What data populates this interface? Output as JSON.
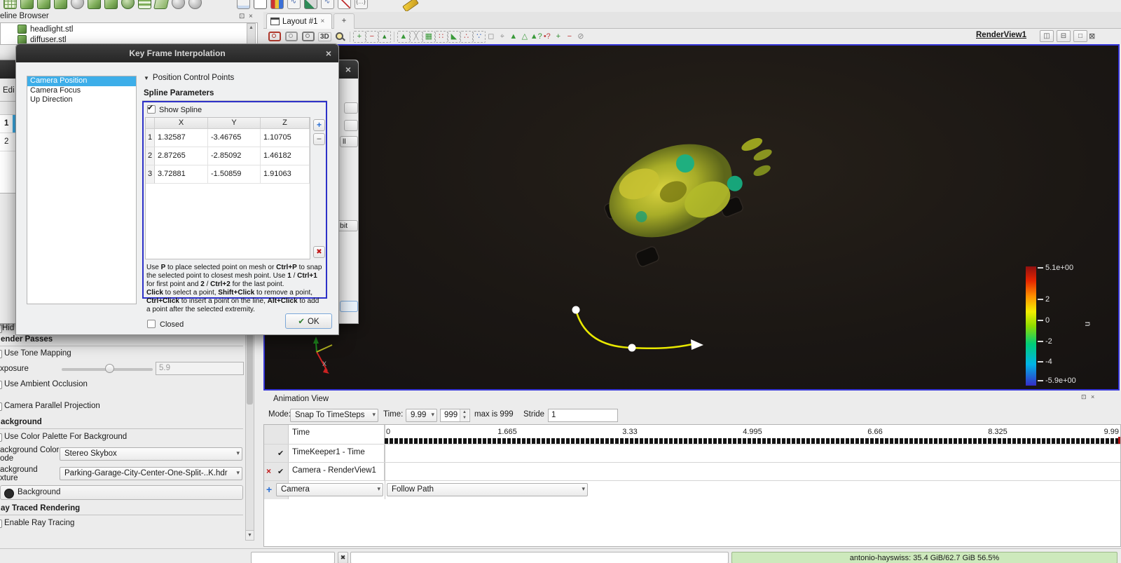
{
  "toolbar_top": {
    "icons": [
      "grid",
      "shape",
      "shape",
      "shape",
      "sphere",
      "shape",
      "shape",
      "globe",
      "layers",
      "plane",
      "sphere",
      "sphere",
      "gap",
      "flag",
      "window",
      "chart",
      "wave",
      "brush",
      "wave",
      "axes",
      "braces",
      "gap",
      "pencil"
    ]
  },
  "pipeline_browser": {
    "title": "eline Browser",
    "float_icon": "⊡",
    "close_icon": "×",
    "scroll_up": "▲",
    "items": [
      {
        "label": "headlight.stl"
      },
      {
        "label": "diffuser.stl"
      }
    ]
  },
  "layout_bar": {
    "tab_label": "Layout #1",
    "tab_close": "×",
    "new_tab_label": "+"
  },
  "view_toolbar": {
    "icons": [
      {
        "k": "cam",
        "c": "#b23a2e"
      },
      {
        "k": "cam",
        "c": "#9a9a9a"
      },
      {
        "k": "cam",
        "c": "#7a7a7a"
      },
      {
        "k": "txt",
        "t": "3D"
      },
      {
        "k": "mag"
      },
      {
        "k": "sep"
      },
      {
        "k": "g",
        "g": "+",
        "c": "#2e8b2e",
        "d": 1
      },
      {
        "k": "g",
        "g": "−",
        "c": "#c03030",
        "d": 1
      },
      {
        "k": "g",
        "g": "▴",
        "c": "#2e8b2e",
        "d": 1
      },
      {
        "k": "sep"
      },
      {
        "k": "g",
        "g": "▲",
        "c": "#3a9a3a",
        "d": 1
      },
      {
        "k": "g",
        "g": "╳",
        "c": "#9a9a9a",
        "d": 1
      },
      {
        "k": "g",
        "g": "▦",
        "c": "#3a9a3a",
        "d": 1
      },
      {
        "k": "g",
        "g": "∷",
        "c": "#c04040",
        "d": 1
      },
      {
        "k": "g",
        "g": "◣",
        "c": "#3a9a3a",
        "d": 1
      },
      {
        "k": "g",
        "g": "∴",
        "c": "#c04040",
        "d": 1
      },
      {
        "k": "g",
        "g": "∵",
        "c": "#3060c0",
        "d": 1
      },
      {
        "k": "g",
        "g": "◻",
        "c": "#8a8a8a"
      },
      {
        "k": "g",
        "g": "⌖",
        "c": "#9a9a9a"
      },
      {
        "k": "g",
        "g": "▲",
        "c": "#3a9a3a"
      },
      {
        "k": "g",
        "g": "△",
        "c": "#3a9a3a"
      },
      {
        "k": "g",
        "g": "▲?",
        "c": "#3a9a3a"
      },
      {
        "k": "g",
        "g": "•?",
        "c": "#c04040"
      },
      {
        "k": "g",
        "g": "+",
        "c": "#2e8b2e"
      },
      {
        "k": "g",
        "g": "−",
        "c": "#c03030"
      },
      {
        "k": "g",
        "g": "⊘",
        "c": "#8a8a8a"
      }
    ],
    "view_label": "RenderView1",
    "split_buttons": [
      "◫",
      "⊟",
      "□"
    ],
    "close_button": "⊠"
  },
  "render_view": {
    "legend": {
      "title": "u",
      "ticks": [
        "5.1e+00",
        "2",
        "0",
        "-2",
        "-4",
        "-5.9e+00"
      ]
    }
  },
  "keyframe_dialog": {
    "title": "Key Frame Interpolation",
    "close": "×",
    "list_items": [
      "Camera Position",
      "Camera Focus",
      "Up Direction"
    ],
    "selected_index": 0,
    "section_arrow": "▼",
    "section_header": "Position Control Points",
    "group_title": "Spline Parameters",
    "show_spline_label": "Show Spline",
    "table_headers": [
      "X",
      "Y",
      "Z"
    ],
    "table_rows": [
      [
        "1.32587",
        "-3.46765",
        "1.10705"
      ],
      [
        "2.87265",
        "-2.85092",
        "1.46182"
      ],
      [
        "3.72881",
        "-1.50859",
        "1.91063"
      ]
    ],
    "add_button": "+",
    "remove_button": "−",
    "delete_button": "✖",
    "help_html": "Use <b>P</b> to place selected point on mesh or <b>Ctrl+P</b> to snap the selected point to closest mesh point. Use <b>1</b> / <b>Ctrl+1</b> for first point and <b>2</b> / <b>Ctrl+2</b> for the last point.<br><b>Click</b> to select a point, <b>Shift+Click</b> to remove a point, <b>Ctrl+Click</b> to insert a point on the line, <b>Alt+Click</b> to add a point after the selected extremity.",
    "closed_label": "Closed",
    "ok_icon": "✔",
    "ok_label": "OK"
  },
  "background_dialog": {
    "close": "×",
    "edit_fragment": "Edi",
    "row_numbers": [
      "1",
      "2"
    ],
    "button_fragments": [
      "ll",
      "bit"
    ]
  },
  "properties_panel": {
    "hidden_fragment": "Hid",
    "render_passes_header": "ender Passes",
    "use_tone_mapping": "Use Tone Mapping",
    "exposure_label": "xposure",
    "exposure_value": "5.9",
    "use_ambient_occlusion": "Use Ambient Occlusion",
    "camera_parallel_projection": "Camera Parallel Projection",
    "background_header": "ackground",
    "use_color_palette": "Use Color Palette For Background",
    "bg_color_mode_label_1": "ackground Color",
    "bg_color_mode_label_2": "ode",
    "bg_color_mode_value": "Stereo Skybox",
    "bg_texture_label_1": "ackground",
    "bg_texture_label_2": "xture",
    "bg_texture_value": "Parking-Garage-City-Center-One-Split-..K.hdr",
    "background_button": "Background",
    "ray_traced_header": "ay Traced Rendering",
    "enable_ray_tracing": "Enable Ray Tracing"
  },
  "animation_view": {
    "title": "Animation View",
    "header_icons": [
      "⊡",
      "×"
    ],
    "mode_label": "Mode:",
    "mode_value": "Snap To TimeSteps",
    "time_label": "Time:",
    "time_value": "9.99",
    "frame_value": "999",
    "max_label": "max is 999",
    "stride_label": "Stride",
    "stride_value": "1",
    "time_row_label": "Time",
    "timeline_labels": [
      "0",
      "1.665",
      "3.33",
      "4.995",
      "6.66",
      "8.325",
      "9.99"
    ],
    "tracks": [
      {
        "name": "TimeKeeper1 - Time",
        "checked": true,
        "removable": false
      },
      {
        "name": "Camera - RenderView1",
        "checked": true,
        "removable": true
      }
    ],
    "add_row": {
      "add_icon": "+",
      "source_value": "Camera",
      "mode_value": "Follow Path"
    }
  },
  "status_bar": {
    "memory_text": "antonio-hayswiss: 35.4 GiB/62.7 GiB 56.5%"
  }
}
